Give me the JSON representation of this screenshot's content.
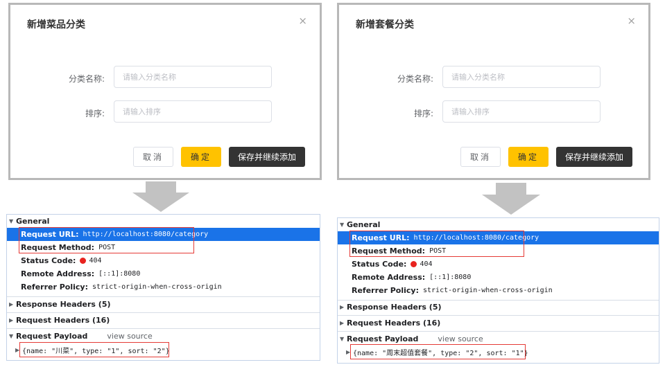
{
  "left": {
    "dialog": {
      "title": "新增菜品分类",
      "close_glyph": "×",
      "name_label": "分类名称:",
      "name_placeholder": "请输入分类名称",
      "sort_label": "排序:",
      "sort_placeholder": "请输入排序",
      "cancel_label": "取消",
      "ok_label": "确定",
      "save_more_label": "保存并继续添加"
    },
    "devtools": {
      "general": "General",
      "request_url_key": "Request URL:",
      "request_url": "http://localhost:8080/category",
      "request_method_key": "Request Method:",
      "request_method": "POST",
      "status_code_key": "Status Code:",
      "status_code": "404",
      "remote_address_key": "Remote Address:",
      "remote_address": "[::1]:8080",
      "referrer_policy_key": "Referrer Policy:",
      "referrer_policy": "strict-origin-when-cross-origin",
      "response_headers": "Response Headers (5)",
      "request_headers": "Request Headers (16)",
      "request_payload": "Request Payload",
      "view_source": "view source",
      "payload": "{name: \"川菜\", type: \"1\", sort: \"2\"}"
    }
  },
  "right": {
    "dialog": {
      "title": "新增套餐分类",
      "close_glyph": "×",
      "name_label": "分类名称:",
      "name_placeholder": "请输入分类名称",
      "sort_label": "排序:",
      "sort_placeholder": "请输入排序",
      "cancel_label": "取消",
      "ok_label": "确定",
      "save_more_label": "保存并继续添加"
    },
    "devtools": {
      "general": "General",
      "request_url_key": "Request URL:",
      "request_url": "http://localhost:8080/category",
      "request_method_key": "Request Method:",
      "request_method": "POST",
      "status_code_key": "Status Code:",
      "status_code": "404",
      "remote_address_key": "Remote Address:",
      "remote_address": "[::1]:8080",
      "referrer_policy_key": "Referrer Policy:",
      "referrer_policy": "strict-origin-when-cross-origin",
      "response_headers": "Response Headers (5)",
      "request_headers": "Request Headers (16)",
      "request_payload": "Request Payload",
      "view_source": "view source",
      "payload": "{name: \"周末超值套餐\", type: \"2\", sort: \"1\"}"
    }
  },
  "colors": {
    "accent_yellow": "#ffc200",
    "dark_button": "#333333",
    "highlight_blue": "#1a73e8",
    "annotation_red": "#e53935",
    "status_red": "#e8231f"
  }
}
